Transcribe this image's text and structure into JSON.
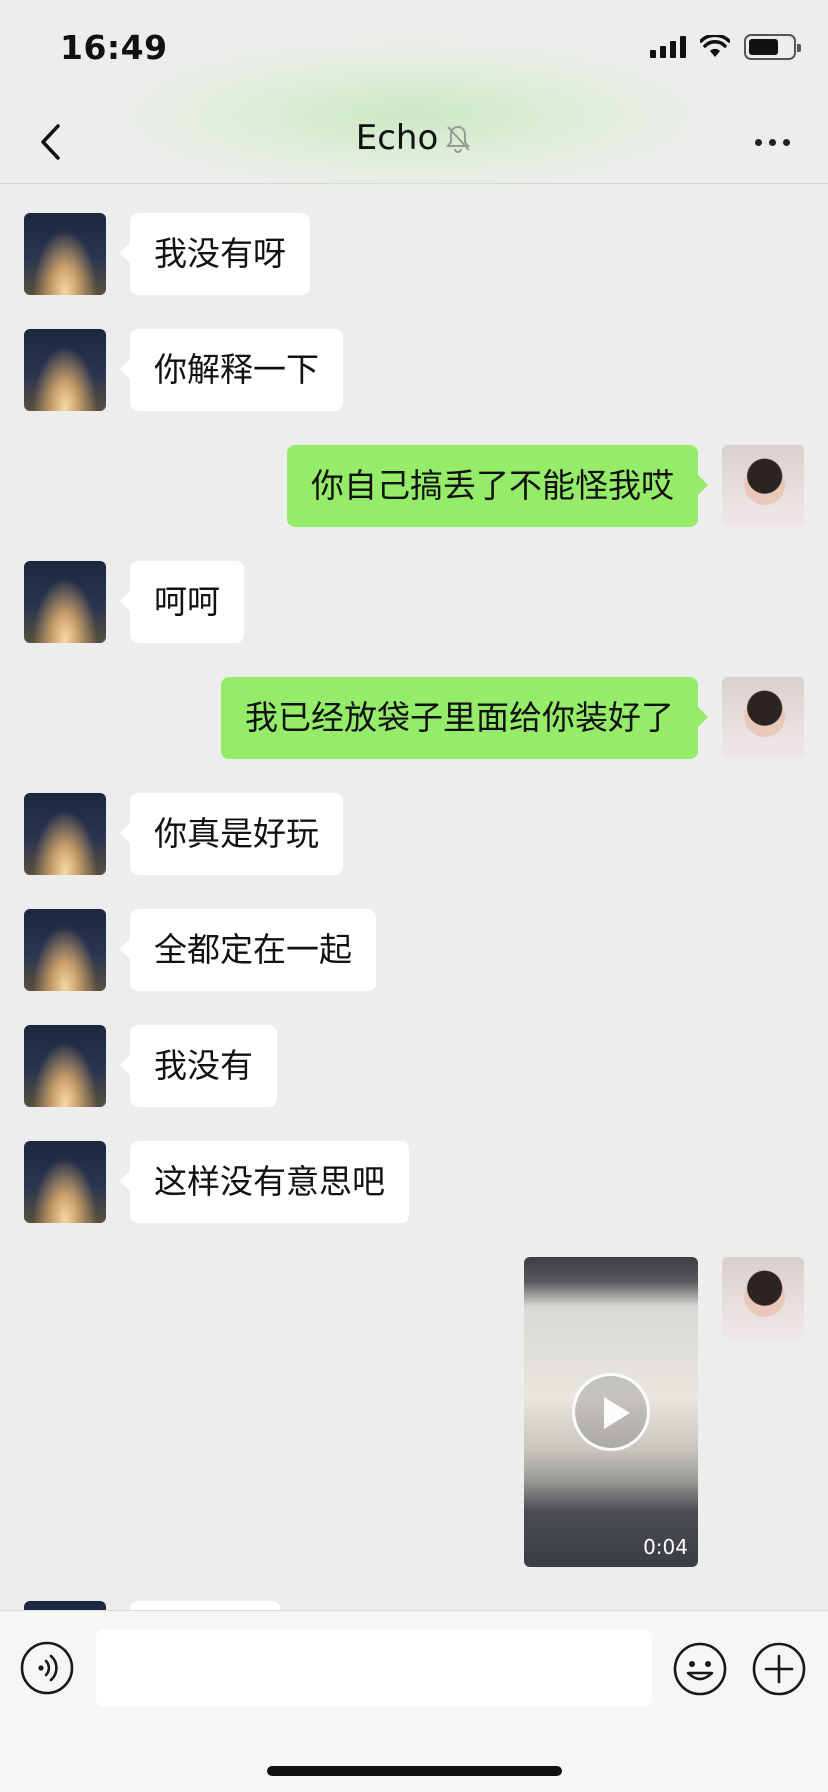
{
  "status_bar": {
    "time": "16:49"
  },
  "nav": {
    "title": "Echo"
  },
  "messages": [
    {
      "side": "in",
      "text": "我没有呀"
    },
    {
      "side": "in",
      "text": "你解释一下"
    },
    {
      "side": "out",
      "text": "你自己搞丢了不能怪我哎"
    },
    {
      "side": "in",
      "text": "呵呵"
    },
    {
      "side": "out",
      "text": "我已经放袋子里面给你装好了"
    },
    {
      "side": "in",
      "text": "你真是好玩"
    },
    {
      "side": "in",
      "text": "全都定在一起"
    },
    {
      "side": "in",
      "text": "我没有"
    },
    {
      "side": "in",
      "text": "这样没有意思吧"
    }
  ],
  "video_message": {
    "side": "out",
    "duration": "0:04"
  },
  "input": {
    "placeholder": ""
  },
  "colors": {
    "incoming_bubble": "#ffffff",
    "outgoing_bubble": "#95ec69",
    "background": "#ededed"
  }
}
